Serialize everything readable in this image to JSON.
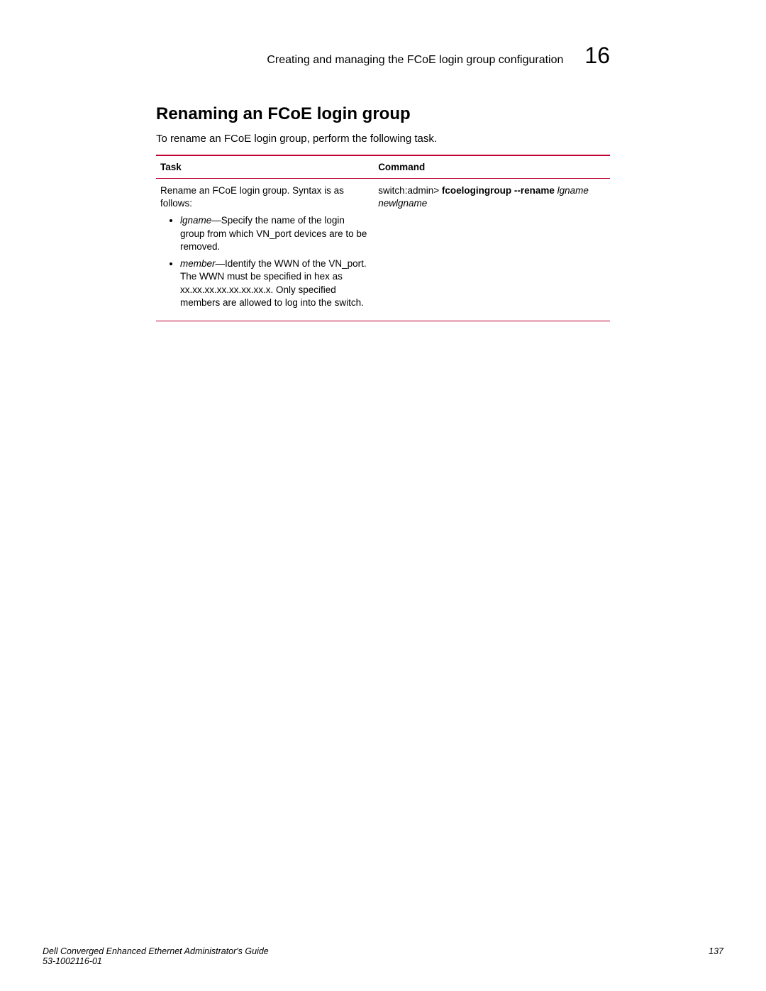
{
  "header": {
    "running_head": "Creating and managing the FCoE login group configuration",
    "chapter_number": "16"
  },
  "section": {
    "title": "Renaming an FCoE login group",
    "intro": "To rename an FCoE login group, perform the following task."
  },
  "table": {
    "head_task": "Task",
    "head_cmd": "Command",
    "task_intro": "Rename an FCoE login group. Syntax is as follows:",
    "bullet1_term": "lgname",
    "bullet1_rest": "—Specify the name of the login group from which VN_port devices are to be removed.",
    "bullet2_term": "member",
    "bullet2_rest": "—Identify the WWN of the VN_port. The WWN must be specified in hex as xx.xx.xx.xx.xx.xx.xx.x. Only specified members are allowed to log into the switch.",
    "cmd_prefix": "switch:admin> ",
    "cmd_bold": "fcoelogingroup --rename",
    "cmd_ital": " lgname newlgname"
  },
  "footer": {
    "line1": "Dell Converged Enhanced Ethernet Administrator's Guide",
    "line2": "53-1002116-01",
    "page": "137"
  }
}
